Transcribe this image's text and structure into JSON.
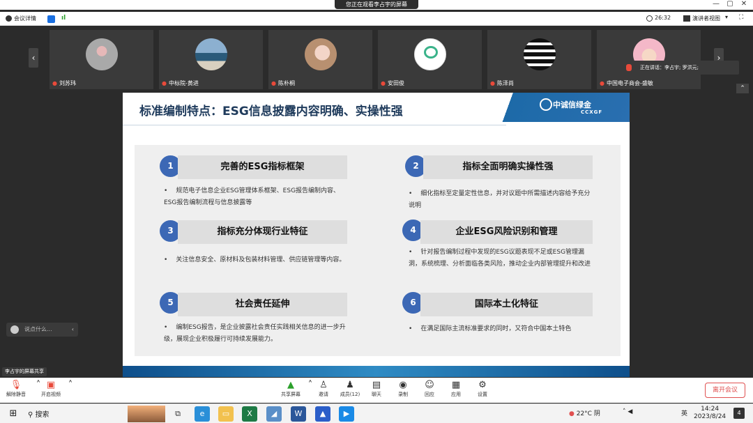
{
  "window": {
    "share_banner": "您正在观看李占宇的屏幕",
    "minimize": "—",
    "restore": "▢",
    "close": "✕"
  },
  "meeting_bar": {
    "details_label": "会议详情",
    "timer": "26:32",
    "view_label": "演讲者视图"
  },
  "gallery": {
    "participants": [
      {
        "name": "刘苏玮"
      },
      {
        "name": "中标院-黄进"
      },
      {
        "name": "陈朴桐"
      },
      {
        "name": "安田俊"
      },
      {
        "name": "陈泽尚"
      },
      {
        "name": "中国电子商会-盛敏"
      }
    ],
    "speaking_label": "正在讲话：李占宇; 罗洪元;"
  },
  "slide": {
    "title": "标准编制特点：ESG信息披露内容明确、实操性强",
    "logo_cn": "中诚信绿金",
    "logo_en": "CCXGF",
    "items": [
      {
        "num": "1",
        "heading": "完善的ESG指标框架",
        "desc": "规范电子信息企业ESG管理体系框架、ESG报告编制内容、ESG报告编制流程与信息披露等"
      },
      {
        "num": "2",
        "heading": "指标全面明确实操性强",
        "desc": "细化指标至定量定性信息，并对议题中所需描述内容给予充分说明"
      },
      {
        "num": "3",
        "heading": "指标充分体现行业特征",
        "desc": "关注信息安全、原材料及包装材料管理、供应链管理等内容。"
      },
      {
        "num": "4",
        "heading": "企业ESG风险识别和管理",
        "desc": "针对报告编制过程中发现的ESG议题表现不足或ESG管理漏洞，系统梳理、分析面临各类风险，推动企业内部管理提升和改进"
      },
      {
        "num": "5",
        "heading": "社会责任延伸",
        "desc": "编制ESG报告，是企业披露社会责任实践相关信息的进一步升级，展现企业积极履行可持续发展能力。"
      },
      {
        "num": "6",
        "heading": "国际本土化特征",
        "desc": "在满足国际主流标准要求的同时，又符合中国本土特色"
      }
    ],
    "bullet": "•"
  },
  "left_panel": {
    "chat_placeholder": "说点什么...",
    "share_label": "李占宇的屏幕共享"
  },
  "controls": {
    "mute_label": "解除静音",
    "video_label": "开启视频",
    "share_label": "共享屏幕",
    "invite_label": "邀请",
    "members_label": "成员(12)",
    "chat_label": "聊天",
    "record_label": "录制",
    "reaction_label": "回应",
    "apps_label": "应用",
    "settings_label": "设置",
    "leave_label": "离开会议"
  },
  "taskbar": {
    "search_label": "搜索",
    "weather": "22°C 阴",
    "ime": "英",
    "time": "14:24",
    "date": "2023/8/24",
    "notifications": "4"
  },
  "colors": {
    "accent_blue": "#3c68b5",
    "title_navy": "#1f3b5c",
    "leave_red": "#e05050"
  }
}
